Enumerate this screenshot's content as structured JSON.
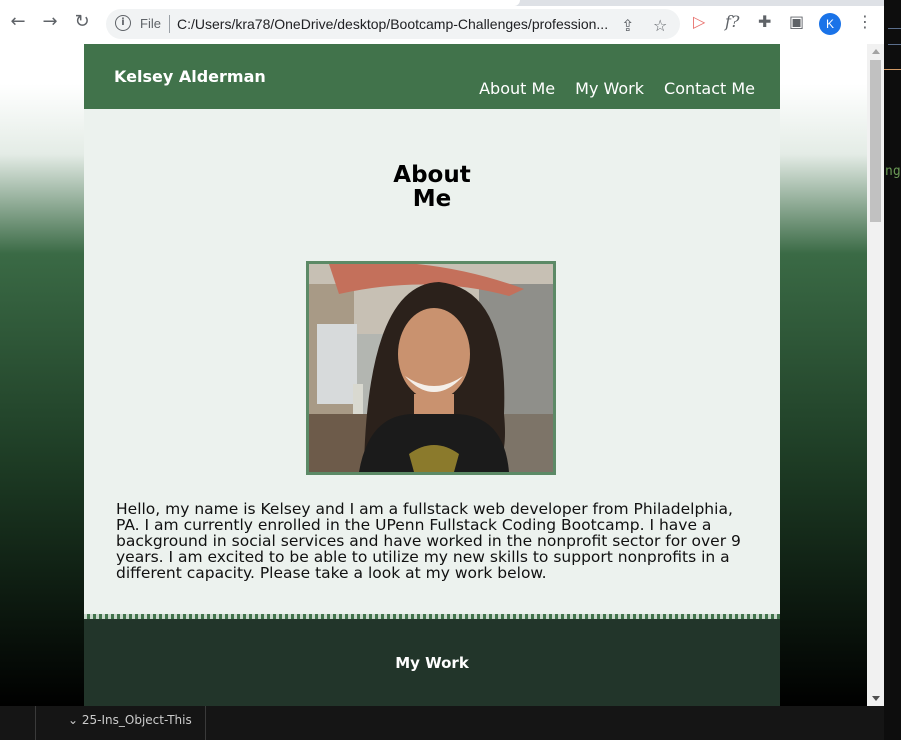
{
  "browser": {
    "file_label": "File",
    "url": "C:/Users/kra78/OneDrive/desktop/Bootcamp-Challenges/profession...",
    "profile_initial": "K",
    "accent": "#1a73e8"
  },
  "site": {
    "name": "Kelsey Alderman",
    "nav": [
      "About Me",
      "My Work",
      "Contact Me"
    ],
    "header_color": "#41734b"
  },
  "about": {
    "title_line1": "About",
    "title_line2": "Me",
    "photo_alt": "Photo of Kelsey Alderman",
    "bio": "Hello, my name is Kelsey and I am a fullstack web developer from Philadelphia, PA. I am currently enrolled in the UPenn Fullstack Coding Bootcamp. I have a background in social services and have worked in the nonprofit sector for over 9 years. I am excited to be able to utilize my new skills to support nonprofits in a different capacity. Please take a look at my work below."
  },
  "work": {
    "title": "My Work"
  },
  "editor": {
    "folder": "25-Ins_Object-This",
    "behind_text": "ngs"
  }
}
